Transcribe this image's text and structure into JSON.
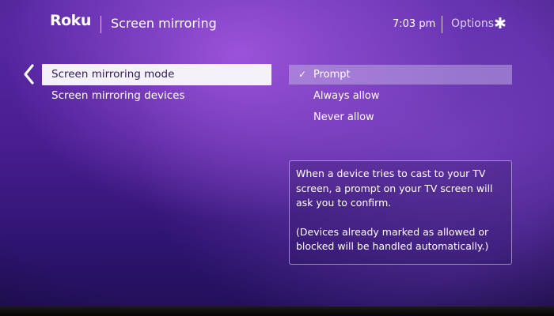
{
  "header": {
    "logo": "Roku",
    "title": "Screen mirroring",
    "time": "7:03 pm",
    "options_label": "Options",
    "options_icon": "asterisk-icon"
  },
  "menu": {
    "items": [
      {
        "label": "Screen mirroring mode",
        "selected": true
      },
      {
        "label": "Screen mirroring devices",
        "selected": false
      }
    ]
  },
  "mode_options": {
    "items": [
      {
        "label": "Prompt",
        "checked": true
      },
      {
        "label": "Always allow",
        "checked": false
      },
      {
        "label": "Never allow",
        "checked": false
      }
    ],
    "check_mark": "✓"
  },
  "info": {
    "paragraph1": "When a device tries to cast to your TV screen, a prompt on your TV screen will ask you to confirm.",
    "paragraph2": "(Devices already marked as allowed or blocked will be handled automatically.)"
  },
  "colors": {
    "background": "#4a1e92",
    "selected_menu_bg": "#f4f1f8",
    "selected_menu_text": "#2e1a5a",
    "selected_option_bg": "#a990cf"
  }
}
